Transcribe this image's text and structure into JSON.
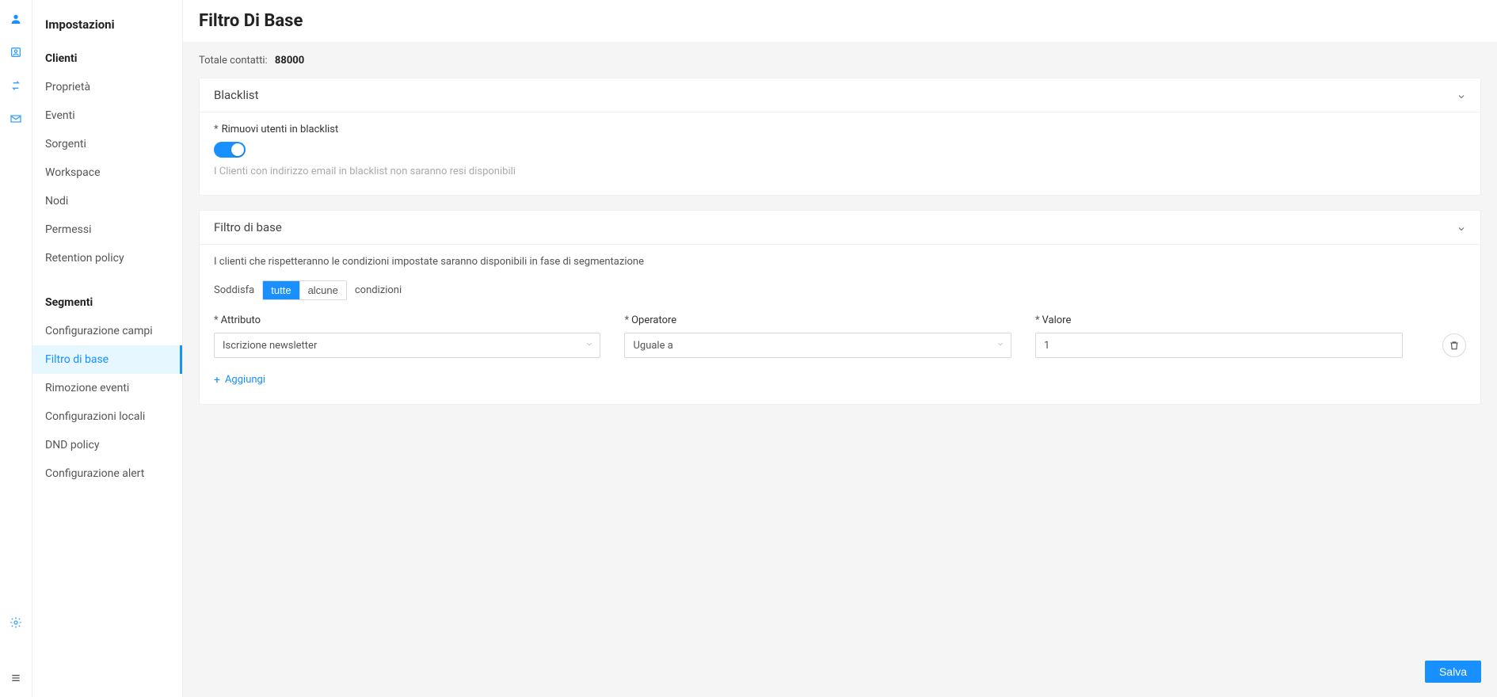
{
  "sidebar": {
    "title": "Impostazioni",
    "groups": [
      {
        "heading": "Clienti",
        "items": [
          {
            "label": "Proprietà",
            "active": false
          },
          {
            "label": "Eventi",
            "active": false
          },
          {
            "label": "Sorgenti",
            "active": false
          },
          {
            "label": "Workspace",
            "active": false
          },
          {
            "label": "Nodi",
            "active": false
          },
          {
            "label": "Permessi",
            "active": false
          },
          {
            "label": "Retention policy",
            "active": false
          }
        ]
      },
      {
        "heading": "Segmenti",
        "items": [
          {
            "label": "Configurazione campi",
            "active": false
          },
          {
            "label": "Filtro di base",
            "active": true
          },
          {
            "label": "Rimozione eventi",
            "active": false
          },
          {
            "label": "Configurazioni locali",
            "active": false
          },
          {
            "label": "DND policy",
            "active": false
          },
          {
            "label": "Configurazione alert",
            "active": false
          }
        ]
      }
    ]
  },
  "rail_icons": {
    "top": [
      "user-icon",
      "user-square-icon",
      "swap-icon",
      "mail-icon"
    ],
    "bottom": [
      "gear-icon",
      "menu-icon"
    ]
  },
  "page": {
    "title": "Filtro Di Base",
    "totals_label": "Totale contatti:",
    "totals_value": "88000"
  },
  "blacklist": {
    "title": "Blacklist",
    "field_label": "Rimuovi utenti in blacklist",
    "toggle_on": true,
    "hint": "I Clienti con indirizzo email in blacklist non saranno resi disponibili"
  },
  "filter": {
    "title": "Filtro di base",
    "description": "I clienti che rispetteranno le condizioni impostate saranno disponibili in fase di segmentazione",
    "satisfy_label": "Soddisfa",
    "satisfy_options": {
      "all": "tutte",
      "some": "alcune"
    },
    "satisfy_selected": "all",
    "conditions_label": "condizioni",
    "columns": {
      "attribute": "Attributo",
      "operator": "Operatore",
      "value": "Valore"
    },
    "rows": [
      {
        "attribute": "Iscrizione newsletter",
        "operator": "Uguale a",
        "value": "1"
      }
    ],
    "add_label": "Aggiungi"
  },
  "actions": {
    "save": "Salva"
  }
}
